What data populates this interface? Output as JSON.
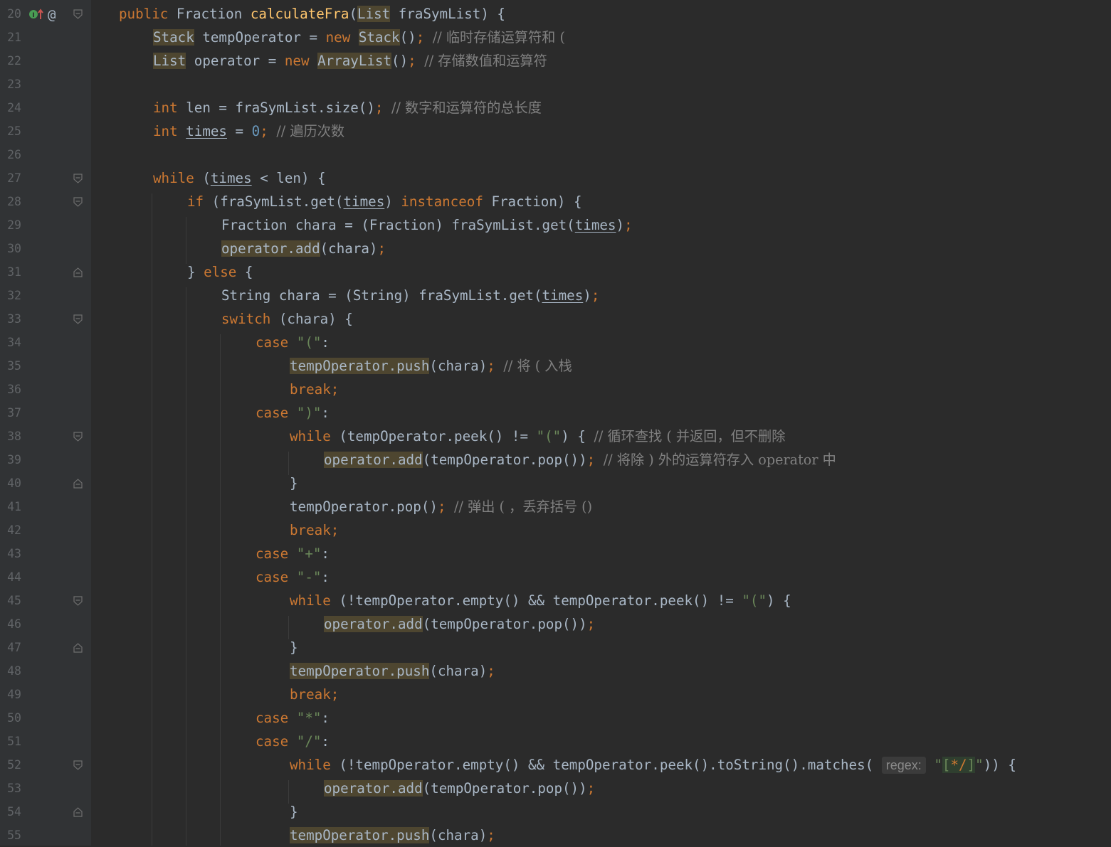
{
  "gutter": {
    "line_numbers": [
      "20",
      "21",
      "22",
      "23",
      "24",
      "25",
      "26",
      "27",
      "28",
      "29",
      "30",
      "31",
      "32",
      "33",
      "34",
      "35",
      "36",
      "37",
      "38",
      "39",
      "40",
      "41",
      "42",
      "43",
      "44",
      "45",
      "46",
      "47",
      "48",
      "49",
      "50",
      "51",
      "52",
      "53",
      "54",
      "55"
    ],
    "markers": {
      "implements_icon": "implementation-arrow-icon",
      "annotation_symbol": "@"
    },
    "fold_icons": {
      "open": "fold-open-icon",
      "close": "fold-close-icon"
    }
  },
  "colors": {
    "background": "#2b2b2b",
    "gutter_background": "#313335",
    "keyword": "#cc7832",
    "function": "#ffc66d",
    "string": "#6a8759",
    "number": "#6897bb",
    "comment": "#808080",
    "text": "#a9b7c6",
    "highlight": "#4e4630"
  },
  "code": {
    "l20": {
      "t1": "public ",
      "t2": "Fraction ",
      "t3": "calculateFra",
      "t4": "(",
      "t5": "List",
      "t6": " fraSymList) {"
    },
    "l21": {
      "t1": "Stack",
      "t2": " tempOperator = ",
      "t3": "new ",
      "t4": "Stack",
      "t5": "()",
      "t6": "; ",
      "t7": "// 临时存储运算符和 ("
    },
    "l22": {
      "t1": "List",
      "t2": " operator = ",
      "t3": "new ",
      "t4": "ArrayList",
      "t5": "()",
      "t6": "; ",
      "t7": "// 存储数值和运算符"
    },
    "l24": {
      "t1": "int ",
      "t2": "len = fraSymList.size()",
      "t3": "; ",
      "t4": "// 数字和运算符的总长度"
    },
    "l25": {
      "t1": "int ",
      "t2": "times",
      "t3": " = ",
      "t4": "0",
      "t5": "; ",
      "t6": "// 遍历次数"
    },
    "l27": {
      "t1": "while ",
      "t2": "(",
      "t3": "times",
      "t4": " < len) {"
    },
    "l28": {
      "t1": "if ",
      "t2": "(fraSymList.get(",
      "t3": "times",
      "t4": ") ",
      "t5": "instanceof ",
      "t6": "Fraction) {"
    },
    "l29": {
      "t1": "Fraction chara = (Fraction) fraSymList.get(",
      "t2": "times",
      "t3": ")",
      "t4": ";"
    },
    "l30": {
      "t1": "operator.add",
      "t2": "(chara)",
      "t3": ";"
    },
    "l31": {
      "t1": "} ",
      "t2": "else ",
      "t3": "{"
    },
    "l32": {
      "t1": "String chara = (String) fraSymList.get(",
      "t2": "times",
      "t3": ")",
      "t4": ";"
    },
    "l33": {
      "t1": "switch ",
      "t2": "(chara) {"
    },
    "l34": {
      "t1": "case ",
      "t2": "\"(\"",
      "t3": ":"
    },
    "l35": {
      "t1": "tempOperator.push",
      "t2": "(chara)",
      "t3": "; ",
      "t4": "// 将 ( 入栈"
    },
    "l36": {
      "t1": "break;"
    },
    "l37": {
      "t1": "case ",
      "t2": "\")\"",
      "t3": ":"
    },
    "l38": {
      "t1": "while ",
      "t2": "(tempOperator.peek() != ",
      "t3": "\"(\"",
      "t4": ") { ",
      "t5": "// 循环查找 ( 并返回，但不删除"
    },
    "l39": {
      "t1": "operator.add",
      "t2": "(tempOperator.pop())",
      "t3": "; ",
      "t4": "// 将除 ) 外的运算符存入 operator 中"
    },
    "l40": {
      "t1": "}"
    },
    "l41": {
      "t1": "tempOperator.pop()",
      "t2": "; ",
      "t3": "// 弹出 ( ，丢弃括号 ()"
    },
    "l42": {
      "t1": "break;"
    },
    "l43": {
      "t1": "case ",
      "t2": "\"+\"",
      "t3": ":"
    },
    "l44": {
      "t1": "case ",
      "t2": "\"-\"",
      "t3": ":"
    },
    "l45": {
      "t1": "while ",
      "t2": "(!tempOperator.empty() && tempOperator.peek() != ",
      "t3": "\"(\"",
      "t4": ") {"
    },
    "l46": {
      "t1": "operator.add",
      "t2": "(tempOperator.pop())",
      "t3": ";"
    },
    "l47": {
      "t1": "}"
    },
    "l48": {
      "t1": "tempOperator.push",
      "t2": "(chara)",
      "t3": ";"
    },
    "l49": {
      "t1": "break;"
    },
    "l50": {
      "t1": "case ",
      "t2": "\"*\"",
      "t3": ":"
    },
    "l51": {
      "t1": "case ",
      "t2": "\"/\"",
      "t3": ":"
    },
    "l52": {
      "t1": "while ",
      "t2": "(!tempOperator.empty() && tempOperator.peek().toString().matches( ",
      "hint": "regex:",
      "t3": " \"",
      "t4": "[",
      "t5": "*/",
      "t6": "]",
      "t7": "\"",
      "t8": ")) {"
    },
    "l53": {
      "t1": "operator.add",
      "t2": "(tempOperator.pop())",
      "t3": ";"
    },
    "l54": {
      "t1": "}"
    },
    "l55": {
      "t1": "tempOperator.push",
      "t2": "(chara)",
      "t3": ";"
    }
  }
}
